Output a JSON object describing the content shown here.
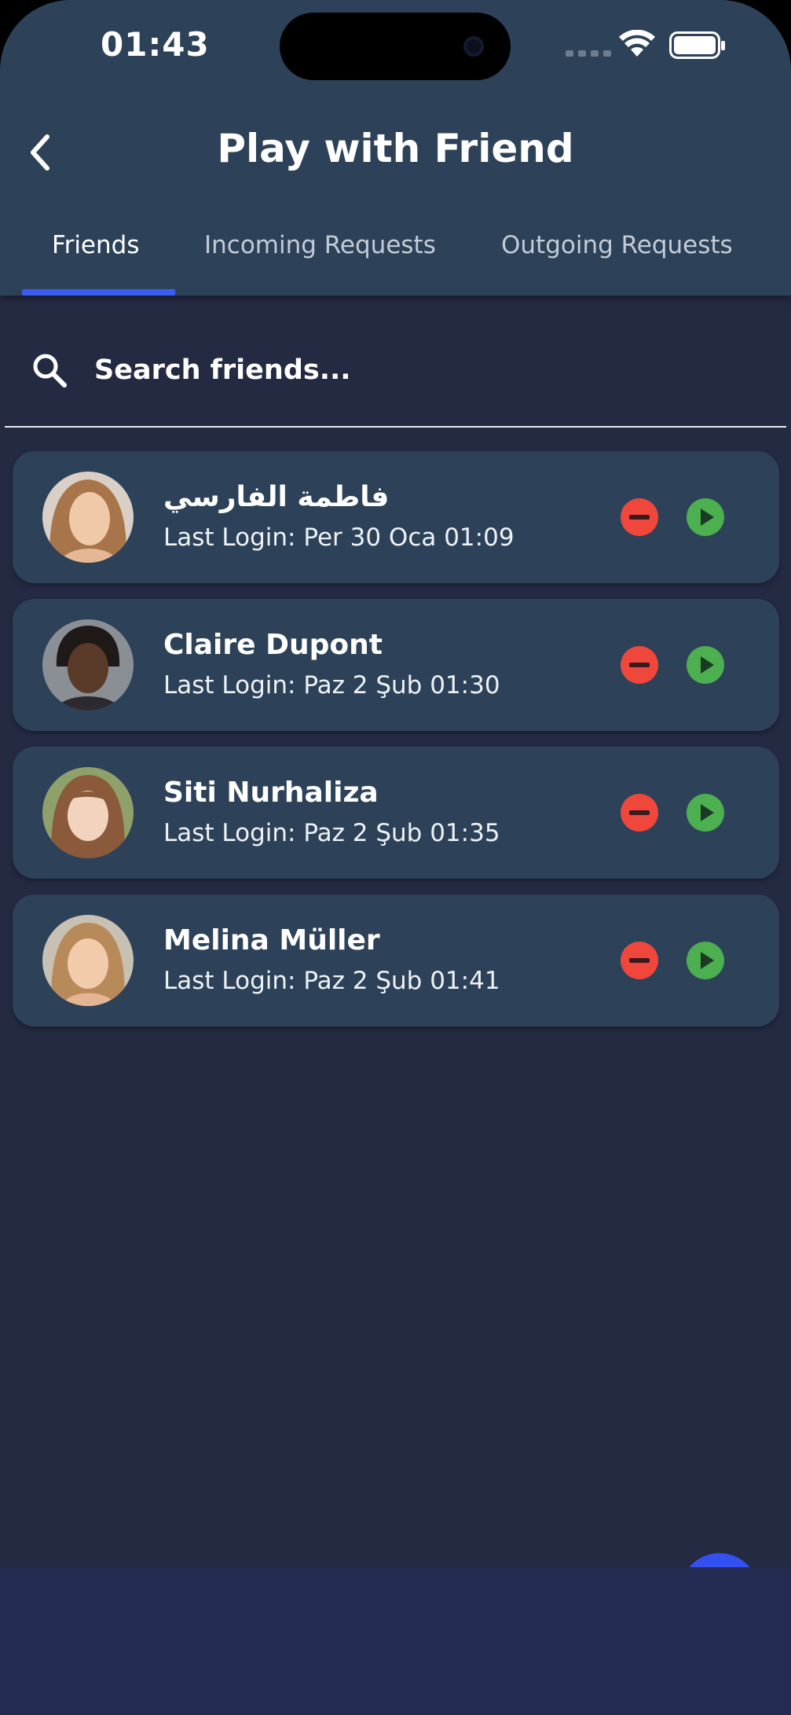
{
  "status_bar": {
    "time": "01:43"
  },
  "header": {
    "title": "Play with Friend"
  },
  "tabs": [
    {
      "label": "Friends",
      "active": true
    },
    {
      "label": "Incoming Requests",
      "active": false
    },
    {
      "label": "Outgoing Requests",
      "active": false
    }
  ],
  "search": {
    "placeholder": "Search friends..."
  },
  "friends": [
    {
      "name": "فاطمة الفارسي",
      "last_login": "Last Login: Per 30 Oca 01:09"
    },
    {
      "name": "Claire Dupont",
      "last_login": "Last Login: Paz 2 Şub 01:30"
    },
    {
      "name": "Siti Nurhaliza",
      "last_login": "Last Login: Paz 2 Şub 01:35"
    },
    {
      "name": "Melina Müller",
      "last_login": "Last Login: Paz 2 Şub 01:41"
    }
  ],
  "colors": {
    "header_bg": "#2d4259",
    "page_bg": "#242a42",
    "card_bg": "#2d4259",
    "tab_indicator": "#3b5cf0",
    "remove": "#f0473c",
    "play": "#4caf50",
    "fab": "#3550f0"
  },
  "icons": {
    "back": "chevron-left-icon",
    "search": "search-icon",
    "remove": "minus-circle-icon",
    "play": "play-circle-icon"
  }
}
